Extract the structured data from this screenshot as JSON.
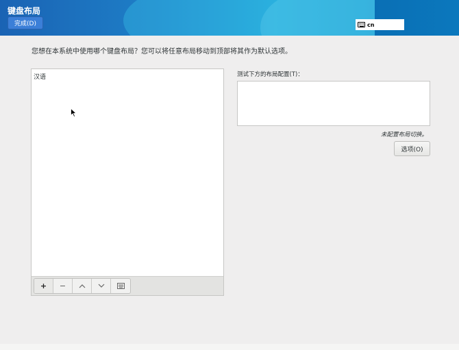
{
  "header": {
    "title": "键盘布局",
    "done_label": "完成(D)",
    "keyboard_indicator": "cn"
  },
  "main": {
    "prompt": "您想在本系统中使用哪个键盘布局？您可以将任意布局移动到顶部将其作为默认选项。",
    "layouts": [
      "汉语"
    ],
    "toolbar": {
      "add": "+",
      "remove": "−",
      "up": "⌃",
      "down": "⌄"
    },
    "test_label": "测试下方的布局配置(T)：",
    "test_value": "",
    "switch_note": "未配置布局切换。",
    "options_label": "选项(O)"
  }
}
